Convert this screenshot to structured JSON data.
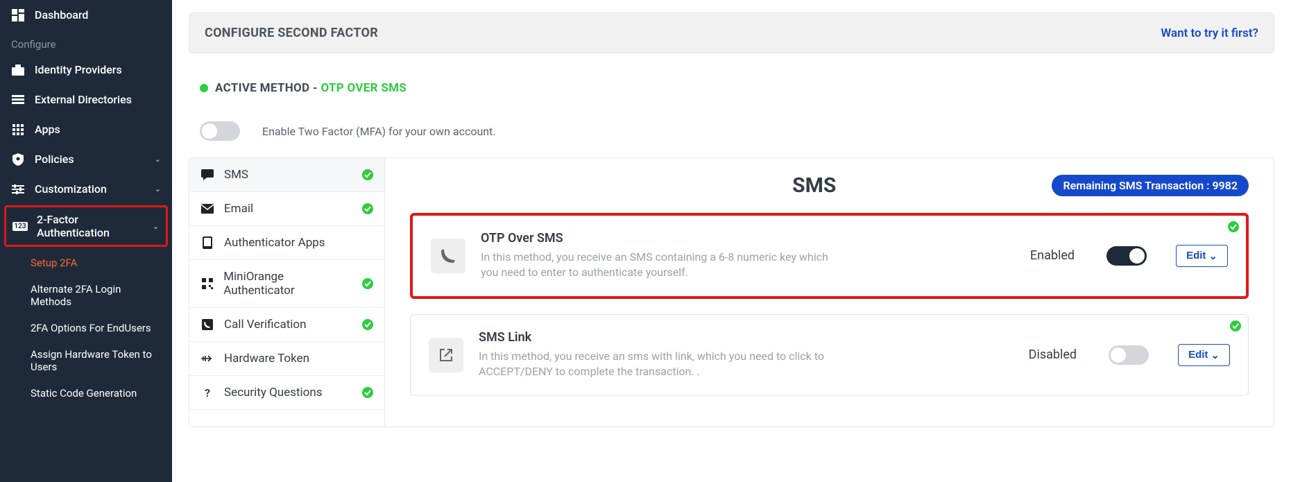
{
  "sidebar": {
    "dashboard": "Dashboard",
    "configure_label": "Configure",
    "items": [
      {
        "label": "Identity Providers"
      },
      {
        "label": "External Directories"
      },
      {
        "label": "Apps"
      },
      {
        "label": "Policies"
      },
      {
        "label": "Customization"
      }
    ],
    "twofa": {
      "line1": "2-Factor",
      "line2": "Authentication"
    },
    "subitems": [
      {
        "label": "Setup 2FA"
      },
      {
        "label": "Alternate 2FA Login Methods"
      },
      {
        "label": "2FA Options For EndUsers"
      },
      {
        "label": "Assign Hardware Token to Users"
      },
      {
        "label": "Static Code Generation"
      }
    ]
  },
  "header": {
    "title": "CONFIGURE SECOND FACTOR",
    "try_link": "Want to try it first?"
  },
  "active_method": {
    "label": "ACTIVE METHOD - ",
    "value": "OTP OVER SMS"
  },
  "mfa_toggle_text": "Enable Two Factor (MFA) for your own account.",
  "tabs": [
    {
      "label": "SMS",
      "check": true,
      "icon": "chat-icon"
    },
    {
      "label": "Email",
      "check": true,
      "icon": "mail-icon"
    },
    {
      "label": "Authenticator Apps",
      "check": false,
      "icon": "phone-icon"
    },
    {
      "label": "MiniOrange Authenticator",
      "check": true,
      "icon": "qr-icon"
    },
    {
      "label": "Call Verification",
      "check": true,
      "icon": "phone-square-icon"
    },
    {
      "label": "Hardware Token",
      "check": false,
      "icon": "usb-icon"
    },
    {
      "label": "Security Questions",
      "check": true,
      "icon": "question-icon"
    }
  ],
  "panel": {
    "title": "SMS",
    "pill": "Remaining SMS Transaction : 9982"
  },
  "cards": [
    {
      "title": "OTP Over SMS",
      "desc": "In this method, you receive an SMS containing a 6-8 numeric key which you need to enter to authenticate yourself.",
      "state": "Enabled",
      "enabled": true,
      "edit": "Edit"
    },
    {
      "title": "SMS Link",
      "desc": "In this method, you receive an sms with link, which you need to click to ACCEPT/DENY to complete the transaction. .",
      "state": "Disabled",
      "enabled": false,
      "edit": "Edit"
    }
  ]
}
